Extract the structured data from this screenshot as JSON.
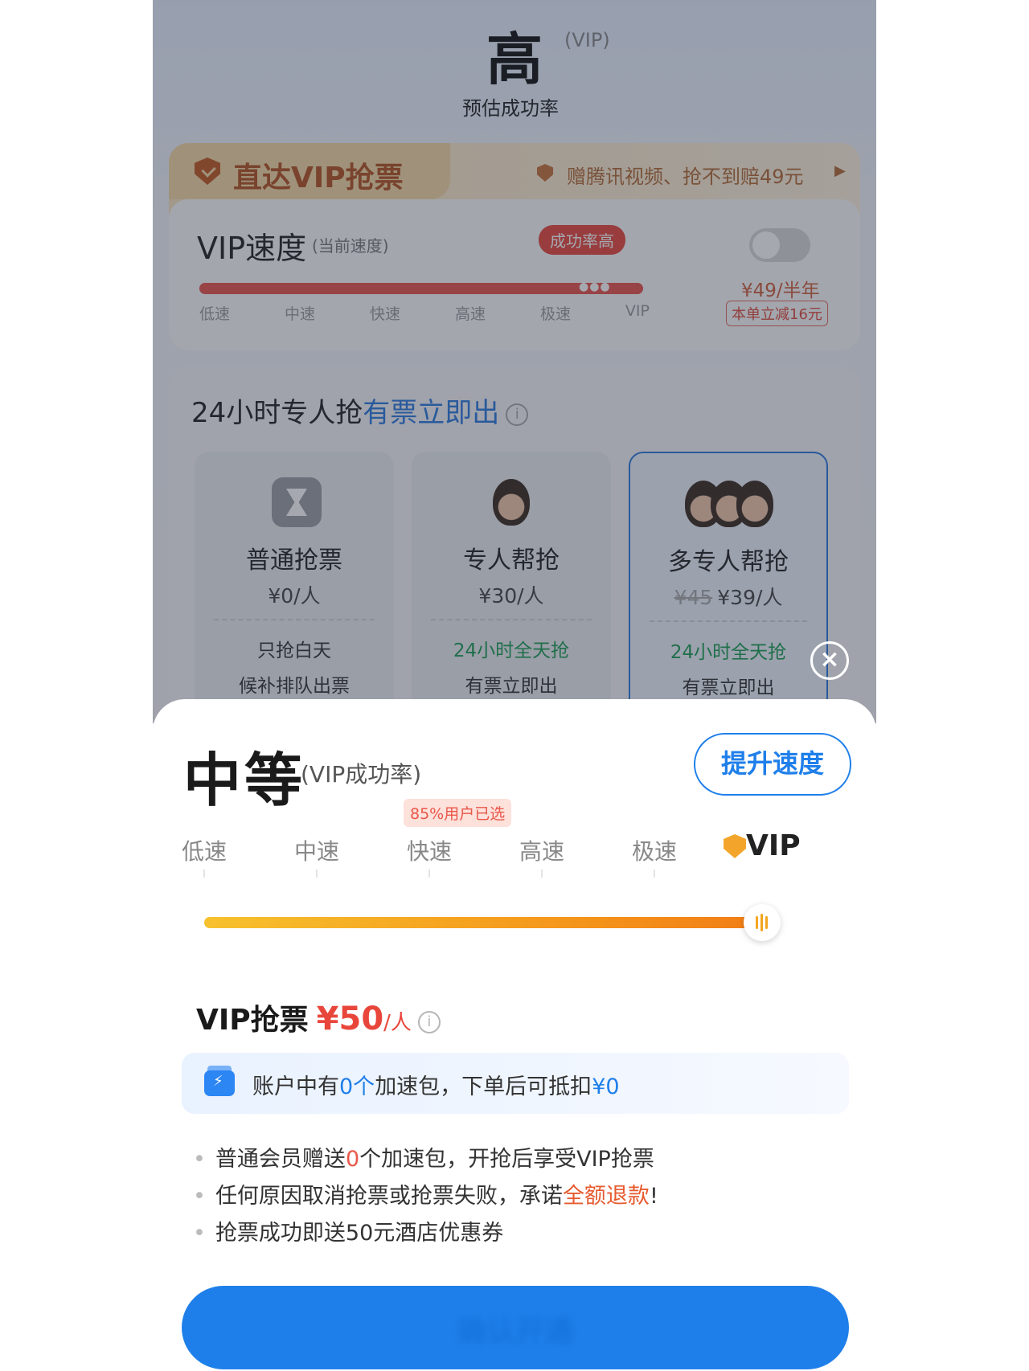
{
  "background": {
    "rate": {
      "value": "高",
      "tag": "(VIP)",
      "subtitle": "预估成功率"
    },
    "vip_card": {
      "tab_title": "直达VIP抢票",
      "promo": "赠腾讯视频、抢不到赔49元",
      "speed_title": "VIP速度",
      "speed_current": "(当前速度)",
      "badge": "成功率高",
      "speed_labels": [
        "低速",
        "中速",
        "快速",
        "高速",
        "极速",
        "VIP"
      ],
      "speed_fill": 1.0,
      "toggle_price": "¥49/半年",
      "toggle_discount": "本单立减16元"
    },
    "grab": {
      "title_prefix": "24小时专人抢",
      "title_highlight": "有票立即出",
      "options": [
        {
          "name": "普通抢票",
          "price": "¥0/人",
          "old_price": "",
          "line1": "只抢白天",
          "line2": "候补排队出票"
        },
        {
          "name": "专人帮抢",
          "price": "¥30/人",
          "old_price": "",
          "line1": "24小时全天抢",
          "line2": "有票立即出"
        },
        {
          "name": "多专人帮抢",
          "price": "¥39/人",
          "old_price": "¥45",
          "line1": "24小时全天抢",
          "line2": "有票立即出"
        }
      ]
    }
  },
  "sheet": {
    "rate": "中等",
    "rate_sub": "(VIP成功率)",
    "boost_button": "提升速度",
    "popular_badge": "85%用户已选",
    "tiers": [
      "低速",
      "中速",
      "快速",
      "高速",
      "极速"
    ],
    "tier_vip": "VIP",
    "slider_value": 1.0,
    "price_title": "VIP抢票",
    "price_amount": "¥50",
    "price_unit": "/人",
    "account": {
      "prefix": "账户中有",
      "count": "0个",
      "middle": "加速包，下单后可抵扣",
      "amount": "¥0"
    },
    "bullets": [
      {
        "prefix": "普通会员赠送",
        "highlight": "0",
        "suffix": "个加速包，开抢后享受VIP抢票"
      },
      {
        "prefix": "任何原因取消抢票或抢票失败，承诺",
        "highlight": "全额退款",
        "suffix": "!"
      },
      {
        "prefix": "抢票成功即送50元酒店优惠券",
        "highlight": "",
        "suffix": ""
      }
    ],
    "cta_label": "确认开通"
  },
  "colors": {
    "accent": "#1f7fea",
    "danger": "#e9463b",
    "success": "#1a9d53",
    "vip_gold": "#f3a52b"
  },
  "icons": [
    "shield-icon",
    "info-icon",
    "hourglass-icon",
    "agent-avatar",
    "close-icon",
    "vip-badge-icon",
    "speed-pack-icon"
  ]
}
